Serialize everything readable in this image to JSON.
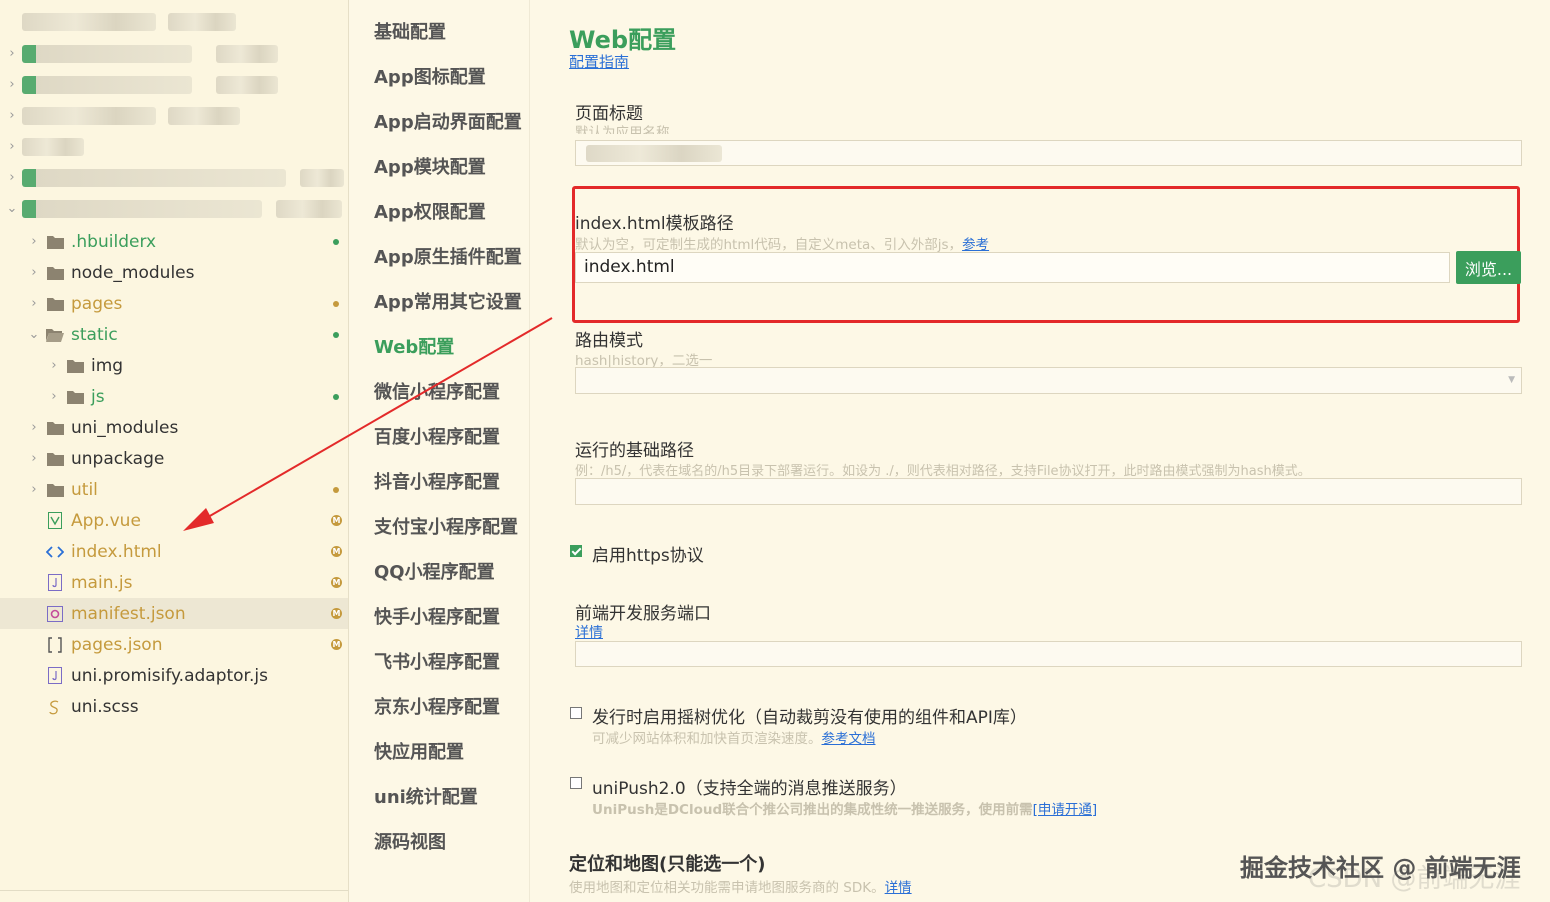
{
  "tree": {
    "items": [
      {
        "label": ".hbuilderx",
        "type": "folder",
        "status": "dot",
        "status_color": "#3b9e5c",
        "text_color": "#3b9e5c"
      },
      {
        "label": "node_modules",
        "type": "folder",
        "status": "",
        "text_color": "#333333"
      },
      {
        "label": "pages",
        "type": "folder",
        "status": "dot",
        "status_color": "#c59a3d",
        "text_color": "#c59a3d"
      },
      {
        "label": "static",
        "type": "folder-open",
        "status": "dot",
        "status_color": "#3b9e5c",
        "text_color": "#3b9e5c"
      },
      {
        "label": "img",
        "type": "folder",
        "status": "",
        "text_color": "#333333"
      },
      {
        "label": "js",
        "type": "folder",
        "status": "dot",
        "status_color": "#3b9e5c",
        "text_color": "#3b9e5c"
      },
      {
        "label": "uni_modules",
        "type": "folder",
        "status": "",
        "text_color": "#333333"
      },
      {
        "label": "unpackage",
        "type": "folder",
        "status": "",
        "text_color": "#333333"
      },
      {
        "label": "util",
        "type": "folder",
        "status": "dot",
        "status_color": "#c59a3d",
        "text_color": "#c59a3d"
      },
      {
        "label": "App.vue",
        "type": "vue-file",
        "status": "M",
        "text_color": "#c59a3d"
      },
      {
        "label": "index.html",
        "type": "html-file",
        "status": "M",
        "text_color": "#c59a3d"
      },
      {
        "label": "main.js",
        "type": "js-file",
        "status": "M",
        "text_color": "#c59a3d"
      },
      {
        "label": "manifest.json",
        "type": "manifest-file",
        "status": "M",
        "text_color": "#c59a3d"
      },
      {
        "label": "pages.json",
        "type": "json-file",
        "status": "M",
        "text_color": "#c59a3d"
      },
      {
        "label": "uni.promisify.adaptor.js",
        "type": "js-file",
        "status": "",
        "text_color": "#333333"
      },
      {
        "label": "uni.scss",
        "type": "scss-file",
        "status": "",
        "text_color": "#333333"
      }
    ]
  },
  "nav": {
    "items": [
      "基础配置",
      "App图标配置",
      "App启动界面配置",
      "App模块配置",
      "App权限配置",
      "App原生插件配置",
      "App常用其它设置",
      "Web配置",
      "微信小程序配置",
      "百度小程序配置",
      "抖音小程序配置",
      "支付宝小程序配置",
      "QQ小程序配置",
      "快手小程序配置",
      "飞书小程序配置",
      "京东小程序配置",
      "快应用配置",
      "uni统计配置",
      "源码视图"
    ],
    "active": "Web配置"
  },
  "main": {
    "title": "Web配置",
    "guide_link": "配置指南",
    "page_title": {
      "label": "页面标题",
      "hint": "默认为应用名称"
    },
    "template_path": {
      "label": "index.html模板路径",
      "hint": "默认为空，可定制生成的html代码，自定义meta、引入外部js，",
      "hint_link": "参考",
      "value": "index.html",
      "browse": "浏览..."
    },
    "router_mode": {
      "label": "路由模式",
      "hint": "hash|history，二选一"
    },
    "base_path": {
      "label": "运行的基础路径",
      "hint": "例：/h5/，代表在域名的/h5目录下部署运行。如设为 ./，则代表相对路径，支持File协议打开，此时路由模式强制为hash模式。"
    },
    "https": {
      "label": "启用https协议",
      "checked": true
    },
    "dev_port": {
      "label": "前端开发服务端口",
      "link": "详情"
    },
    "tree_shaking": {
      "label": "发行时启用摇树优化（自动裁剪没有使用的组件和API库）",
      "hint": "可减少网站体积和加快首页渲染速度。",
      "hint_link": "参考文档",
      "checked": false
    },
    "unipush": {
      "label": "uniPush2.0（支持全端的消息推送服务）",
      "hint": "UniPush是DCloud联合个推公司推出的集成性统一推送服务，使用前需",
      "hint_link": "[申请开通]",
      "checked": false
    },
    "location": {
      "label": "定位和地图(只能选一个)",
      "hint": "使用地图和定位相关功能需申请地图服务商的 SDK。",
      "hint_link": "详情"
    }
  },
  "watermark": {
    "text": "掘金技术社区 @ 前端无涯",
    "text_faint": "CSDN @前端无涯"
  },
  "colors": {
    "accent": "#3b9e5c",
    "modified": "#c59a3d",
    "highlight_box": "#e32a2a",
    "link": "#2a6fd6"
  }
}
